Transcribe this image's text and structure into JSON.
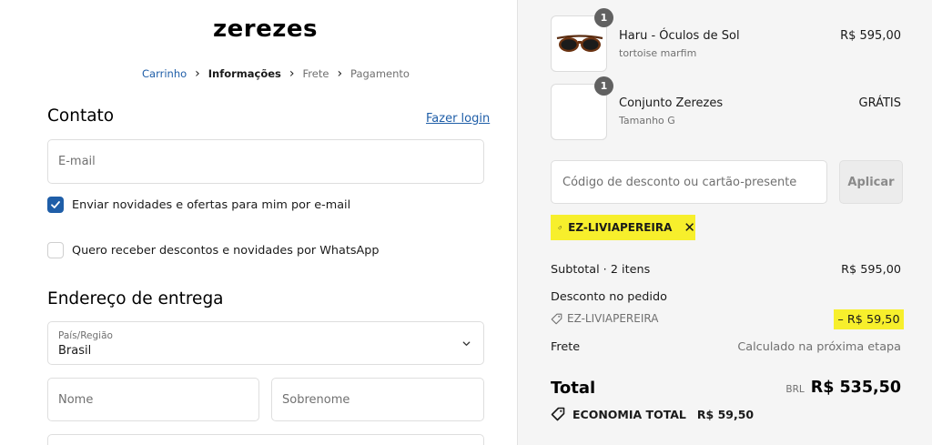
{
  "brand": {
    "logo": "zerezes"
  },
  "breadcrumb": {
    "cart": "Carrinho",
    "info": "Informações",
    "shipping": "Frete",
    "payment": "Pagamento"
  },
  "contact": {
    "heading": "Contato",
    "login_link": "Fazer login",
    "email_placeholder": "E-mail",
    "newsletter_label": "Enviar novidades e ofertas para mim por e-mail",
    "newsletter_checked": true,
    "whatsapp_label": "Quero receber descontos e novidades por WhatsApp",
    "whatsapp_checked": false
  },
  "delivery": {
    "heading": "Endereço de entrega",
    "country_label": "País/Região",
    "country_value": "Brasil",
    "first_name_placeholder": "Nome",
    "last_name_placeholder": "Sobrenome"
  },
  "order": {
    "items": [
      {
        "name": "Haru - Óculos de Sol",
        "variant": "tortoise marfim",
        "price": "R$ 595,00",
        "qty": "1"
      },
      {
        "name": "Conjunto Zerezes",
        "variant": "Tamanho G",
        "price": "GRÁTIS",
        "qty": "1"
      }
    ],
    "discount_placeholder": "Código de desconto ou cartão-presente",
    "apply_label": "Aplicar",
    "applied_code": "EZ-LIVIAPEREIRA",
    "subtotal_label": "Subtotal · 2 itens",
    "subtotal_value": "R$ 595,00",
    "discount_label": "Desconto no pedido",
    "discount_code": "EZ-LIVIAPEREIRA",
    "discount_value": "– R$ 59,50",
    "shipping_label": "Frete",
    "shipping_value": "Calculado na próxima etapa",
    "total_label": "Total",
    "currency": "BRL",
    "total_value": "R$ 535,50",
    "savings_label": "ECONOMIA TOTAL",
    "savings_value": "R$ 59,50"
  },
  "colors": {
    "accent": "#1f5ea8",
    "highlight": "#f7ef2c",
    "sidebar_bg": "#f5f5f5"
  }
}
